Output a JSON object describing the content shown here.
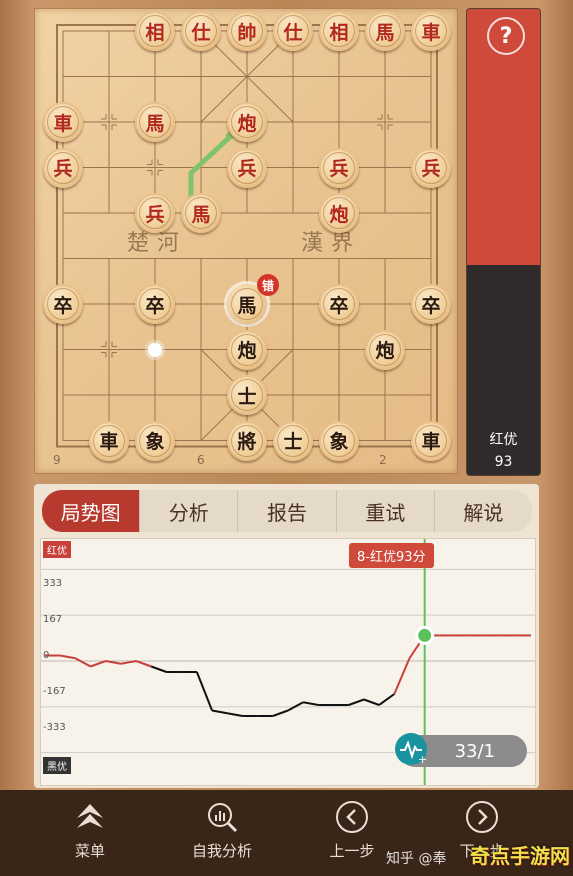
{
  "board": {
    "file_numbers": [
      "9",
      "6",
      "2"
    ],
    "river_left": "楚河",
    "river_right": "漢界",
    "pieces": [
      {
        "char": "相",
        "color": "red",
        "row": 0,
        "col": 2
      },
      {
        "char": "仕",
        "color": "red",
        "row": 0,
        "col": 3
      },
      {
        "char": "帥",
        "color": "red",
        "row": 0,
        "col": 4
      },
      {
        "char": "仕",
        "color": "red",
        "row": 0,
        "col": 5
      },
      {
        "char": "相",
        "color": "red",
        "row": 0,
        "col": 6
      },
      {
        "char": "馬",
        "color": "red",
        "row": 0,
        "col": 7
      },
      {
        "char": "車",
        "color": "red",
        "row": 0,
        "col": 8
      },
      {
        "char": "車",
        "color": "red",
        "row": 2,
        "col": 0
      },
      {
        "char": "馬",
        "color": "red",
        "row": 2,
        "col": 2
      },
      {
        "char": "炮",
        "color": "red",
        "row": 2,
        "col": 4
      },
      {
        "char": "兵",
        "color": "red",
        "row": 3,
        "col": 0
      },
      {
        "char": "兵",
        "color": "red",
        "row": 3,
        "col": 4
      },
      {
        "char": "兵",
        "color": "red",
        "row": 3,
        "col": 6
      },
      {
        "char": "兵",
        "color": "red",
        "row": 3,
        "col": 8
      },
      {
        "char": "兵",
        "color": "red",
        "row": 4,
        "col": 2
      },
      {
        "char": "馬",
        "color": "red",
        "row": 4,
        "col": 3
      },
      {
        "char": "炮",
        "color": "red",
        "row": 4,
        "col": 6
      },
      {
        "char": "卒",
        "color": "black",
        "row": 6,
        "col": 0
      },
      {
        "char": "卒",
        "color": "black",
        "row": 6,
        "col": 2
      },
      {
        "char": "馬",
        "color": "black",
        "row": 6,
        "col": 4,
        "selected": true
      },
      {
        "char": "卒",
        "color": "black",
        "row": 6,
        "col": 6
      },
      {
        "char": "卒",
        "color": "black",
        "row": 6,
        "col": 8
      },
      {
        "char": "炮",
        "color": "black",
        "row": 7,
        "col": 4
      },
      {
        "char": "炮",
        "color": "black",
        "row": 7,
        "col": 7
      },
      {
        "char": "士",
        "color": "black",
        "row": 8,
        "col": 4
      },
      {
        "char": "車",
        "color": "black",
        "row": 9,
        "col": 1
      },
      {
        "char": "象",
        "color": "black",
        "row": 9,
        "col": 2
      },
      {
        "char": "將",
        "color": "black",
        "row": 9,
        "col": 4
      },
      {
        "char": "士",
        "color": "black",
        "row": 9,
        "col": 5
      },
      {
        "char": "象",
        "color": "black",
        "row": 9,
        "col": 6
      },
      {
        "char": "車",
        "color": "black",
        "row": 9,
        "col": 8
      }
    ],
    "error_badge": "错",
    "move_arrow": {
      "from_row": 4,
      "from_col": 3,
      "to_row": 2,
      "to_col": 4
    },
    "move_dot": {
      "row": 7,
      "col": 2
    }
  },
  "eval_bar": {
    "help": "?",
    "label": "红优",
    "score": "93",
    "red_fraction": 0.55
  },
  "tabs": [
    {
      "label": "局势图",
      "active": true
    },
    {
      "label": "分析",
      "active": false
    },
    {
      "label": "报告",
      "active": false
    },
    {
      "label": "重试",
      "active": false
    },
    {
      "label": "解说",
      "active": false
    }
  ],
  "graph": {
    "top_tag": "红优",
    "bottom_tag": "黑优",
    "y_ticks": [
      "333",
      "167",
      "0",
      "-167",
      "-333"
    ],
    "score_label": "8-红优93分",
    "move_counter": "33/1",
    "colors": {
      "red": "#c8403a",
      "black": "#111111",
      "cursor": "#5cc05c"
    }
  },
  "chart_data": {
    "type": "line",
    "ylim": [
      -400,
      400
    ],
    "y_ticks": [
      333,
      167,
      0,
      -167,
      -333
    ],
    "series": [
      {
        "values": [
          20,
          20,
          10,
          -20,
          0,
          -10,
          0,
          -20,
          -40,
          -40,
          -40,
          -180,
          -190,
          -200,
          -200,
          -200,
          -180,
          -150,
          -160,
          -160,
          -160,
          -140,
          -160,
          -120,
          10,
          93,
          93,
          93,
          93,
          93,
          93,
          93,
          93
        ]
      }
    ],
    "current_move": 25
  },
  "nav": [
    {
      "label": "菜单",
      "icon": "menu-icon"
    },
    {
      "label": "自我分析",
      "icon": "analysis-icon"
    },
    {
      "label": "上一步",
      "icon": "prev-icon"
    },
    {
      "label": "下一步",
      "icon": "next-icon"
    }
  ],
  "watermark": "知乎 @奉",
  "logo_watermark": "奇点手游网"
}
